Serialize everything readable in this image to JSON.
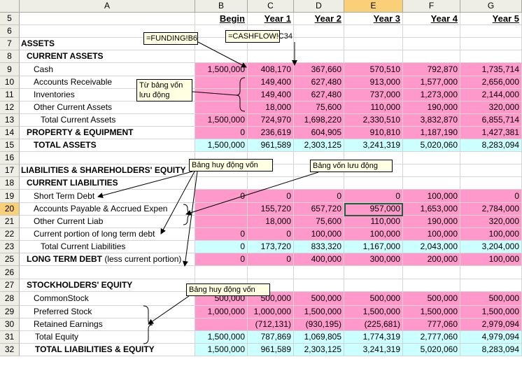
{
  "columns": [
    "A",
    "B",
    "C",
    "D",
    "E",
    "F",
    "G"
  ],
  "rows": [
    "5",
    "6",
    "7",
    "8",
    "9",
    "10",
    "11",
    "12",
    "13",
    "14",
    "15",
    "16",
    "17",
    "18",
    "19",
    "20",
    "21",
    "22",
    "23",
    "25",
    "26",
    "27",
    "28",
    "29",
    "30",
    "31",
    "32"
  ],
  "selected_column": "E",
  "selected_row": "20",
  "headings": {
    "begin": "Begin",
    "y1": "Year 1",
    "y2": "Year 2",
    "y3": "Year 3",
    "y4": "Year 4",
    "y5": "Year 5"
  },
  "labels": {
    "assets": "ASSETS",
    "current_assets": "CURRENT ASSETS",
    "cash": "Cash",
    "ar": "Accounts Receivable",
    "inv": "Inventories",
    "oca": "Other Current Assets",
    "tca": "Total Current Assets",
    "ppe": "PROPERTY & EQUIPMENT",
    "ta": "TOTAL ASSETS",
    "lse": "LIABILITIES & SHAREHOLDERS' EQUITY",
    "cl": "CURRENT LIABILITIES",
    "std": "Short Term Debt",
    "ap": "Accounts Payable & Accrued Expen",
    "ocl": "Other Current Liab",
    "cpltd": "Current portion of long term debt",
    "tcl": "Total Current Liabilities",
    "ltd_bold": "LONG TERM DEBT",
    "ltd_rest": " (less current portion)",
    "se": "STOCKHOLDERS' EQUITY",
    "cs": "CommonStock",
    "ps": "Preferred Stock",
    "re": "Retained Earnings",
    "te": "Total Equity",
    "tle": "TOTAL LIABILITIES & EQUITY"
  },
  "values": {
    "cash": [
      "1,500,000",
      "408,170",
      "367,660",
      "570,510",
      "792,870",
      "1,735,714"
    ],
    "ar": [
      "",
      "149,400",
      "627,480",
      "913,000",
      "1,577,000",
      "2,656,000"
    ],
    "inv": [
      "",
      "149,400",
      "627,480",
      "737,000",
      "1,273,000",
      "2,144,000"
    ],
    "oca": [
      "",
      "18,000",
      "75,600",
      "110,000",
      "190,000",
      "320,000"
    ],
    "tca": [
      "1,500,000",
      "724,970",
      "1,698,220",
      "2,330,510",
      "3,832,870",
      "6,855,714"
    ],
    "ppe": [
      "0",
      "236,619",
      "604,905",
      "910,810",
      "1,187,190",
      "1,427,381"
    ],
    "ta": [
      "1,500,000",
      "961,589",
      "2,303,125",
      "3,241,319",
      "5,020,060",
      "8,283,094"
    ],
    "std": [
      "0",
      "0",
      "0",
      "0",
      "100,000",
      "0"
    ],
    "ap": [
      "",
      "155,720",
      "657,720",
      "957,000",
      "1,653,000",
      "2,784,000"
    ],
    "ocl": [
      "",
      "18,000",
      "75,600",
      "110,000",
      "190,000",
      "320,000"
    ],
    "cpltd": [
      "0",
      "0",
      "100,000",
      "100,000",
      "100,000",
      "100,000"
    ],
    "tcl": [
      "0",
      "173,720",
      "833,320",
      "1,167,000",
      "2,043,000",
      "3,204,000"
    ],
    "ltd": [
      "0",
      "0",
      "400,000",
      "300,000",
      "200,000",
      "100,000"
    ],
    "cs": [
      "500,000",
      "500,000",
      "500,000",
      "500,000",
      "500,000",
      "500,000"
    ],
    "ps": [
      "1,000,000",
      "1,000,000",
      "1,500,000",
      "1,500,000",
      "1,500,000",
      "1,500,000"
    ],
    "re": [
      "",
      "(712,131)",
      "(930,195)",
      "(225,681)",
      "777,060",
      "2,979,094"
    ],
    "te": [
      "1,500,000",
      "787,869",
      "1,069,805",
      "1,774,319",
      "2,777,060",
      "4,979,094"
    ],
    "tle": [
      "1,500,000",
      "961,589",
      "2,303,125",
      "3,241,319",
      "5,020,060",
      "8,283,094"
    ]
  },
  "notes": {
    "funding": "=FUNDING!B6",
    "cashflow": "=CASHFLOW!C34",
    "working_capital_line1": "Từ bảng vốn",
    "working_capital_line2": "lưu động",
    "funding_table_1": "Bảng huy động vốn",
    "working_capital_table": "Bảng vốn lưu động",
    "funding_table_2": "Bảng huy động vốn"
  }
}
